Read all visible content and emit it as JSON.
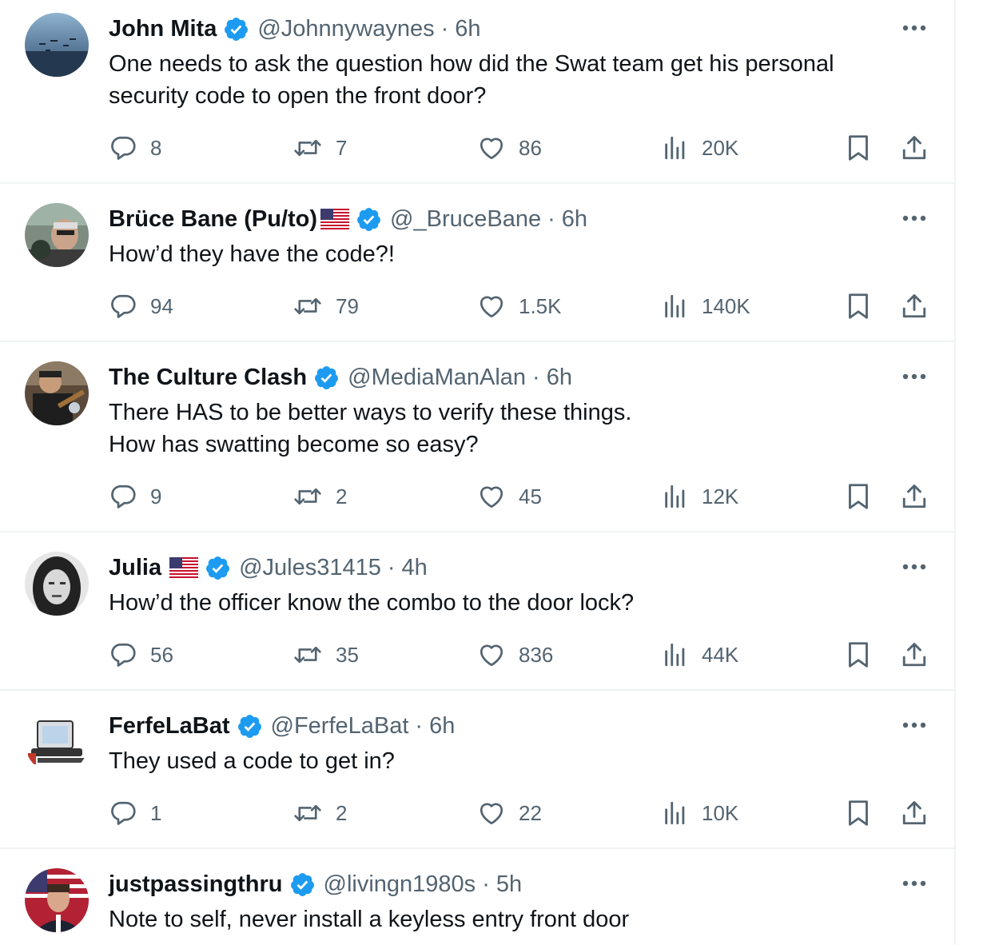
{
  "colors": {
    "text": "#0f1419",
    "muted": "#536471",
    "verified": "#1d9bf0",
    "divider": "#eff3f4"
  },
  "icons": [
    "verified-badge-icon",
    "us-flag-icon",
    "more-icon",
    "reply-icon",
    "retweet-icon",
    "like-icon",
    "views-icon",
    "bookmark-icon",
    "share-icon"
  ],
  "tweets": [
    {
      "name": "John Mita",
      "flag": false,
      "handle": "@Johnnywaynes",
      "separator": "·",
      "time": "6h",
      "lines": [
        "One needs to ask the question how did the Swat team get his personal",
        "security code to open the front door?"
      ],
      "replies": "8",
      "retweets": "7",
      "likes": "86",
      "views": "20K"
    },
    {
      "name": "Brüce Bane (Pu/to)",
      "flag": true,
      "handle": "@_BruceBane",
      "separator": "·",
      "time": "6h",
      "lines": [
        "How’d they have the code?!"
      ],
      "replies": "94",
      "retweets": "79",
      "likes": "1.5K",
      "views": "140K"
    },
    {
      "name": "The Culture Clash",
      "flag": false,
      "handle": "@MediaManAlan",
      "separator": "·",
      "time": "6h",
      "lines": [
        "There HAS to be better ways to verify these things.",
        "How has swatting become so easy?"
      ],
      "replies": "9",
      "retweets": "2",
      "likes": "45",
      "views": "12K"
    },
    {
      "name": "Julia",
      "flag": true,
      "handle": "@Jules31415",
      "separator": "·",
      "time": "4h",
      "lines": [
        "How’d the officer know the combo to the door lock?"
      ],
      "replies": "56",
      "retweets": "35",
      "likes": "836",
      "views": "44K"
    },
    {
      "name": "FerfeLaBat",
      "flag": false,
      "handle": "@FerfeLaBat",
      "separator": "·",
      "time": "6h",
      "lines": [
        "They used a code to get in?"
      ],
      "replies": "1",
      "retweets": "2",
      "likes": "22",
      "views": "10K"
    },
    {
      "name": "justpassingthru",
      "flag": false,
      "handle": "@livingn1980s",
      "separator": "·",
      "time": "5h",
      "lines": [
        "Note to self, never install a keyless entry front door"
      ],
      "replies": "",
      "retweets": "",
      "likes": "",
      "views": ""
    }
  ]
}
